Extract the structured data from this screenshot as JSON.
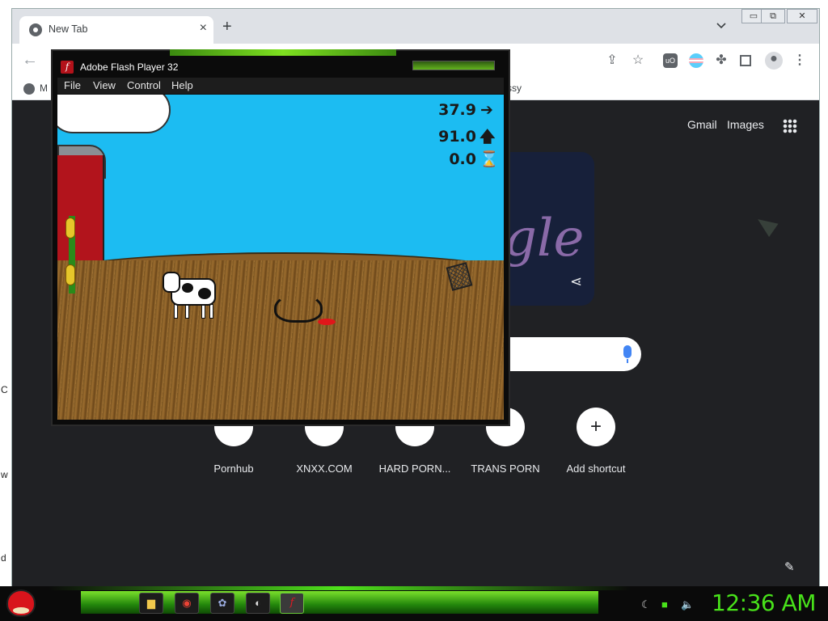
{
  "desktop": {
    "edge_chars": [
      "C",
      "w",
      "d"
    ]
  },
  "browser": {
    "tab": {
      "title": "New Tab",
      "close": "×"
    },
    "new_tab": "+",
    "window_buttons": [
      "▭",
      "⧉",
      "✕"
    ],
    "toolbar": {
      "back": "←",
      "icons": [
        "share-icon",
        "star-icon",
        "ublock-icon",
        "flag-icon",
        "extensions-icon",
        "sidepanel-icon",
        "profile-icon",
        "menu-icon"
      ]
    },
    "bookmarks": {
      "left_fragment": "M",
      "right_fragment": "ssy"
    }
  },
  "ntp": {
    "links": [
      "Gmail",
      "Images"
    ],
    "doodle_text": "gle",
    "shortcuts": [
      {
        "label": "Pornhub"
      },
      {
        "label": "XNXX.COM"
      },
      {
        "label": "HARD PORN..."
      },
      {
        "label": "TRANS PORN"
      },
      {
        "label": "Add shortcut"
      }
    ]
  },
  "flash": {
    "title": "Adobe Flash Player 32",
    "menu": [
      "File",
      "View",
      "Control",
      "Help"
    ],
    "hud": [
      {
        "value": "37.9",
        "symbol": "➔"
      },
      {
        "value": "91.0",
        "symbol": "🡅"
      },
      {
        "value": "0.0",
        "symbol": "⌛"
      }
    ]
  },
  "taskbar": {
    "clock": "12:36 AM",
    "tasks": [
      "folder-icon",
      "chrome-icon",
      "paint-icon",
      "media-icon",
      "flash-icon"
    ],
    "tray": [
      "network-icon",
      "monitor-icon",
      "volume-icon"
    ]
  },
  "colors": {
    "sky": "#1cbcf2",
    "ntp_bg": "#202124",
    "clock": "#48e21a",
    "taskbar_green": "#23870c"
  }
}
